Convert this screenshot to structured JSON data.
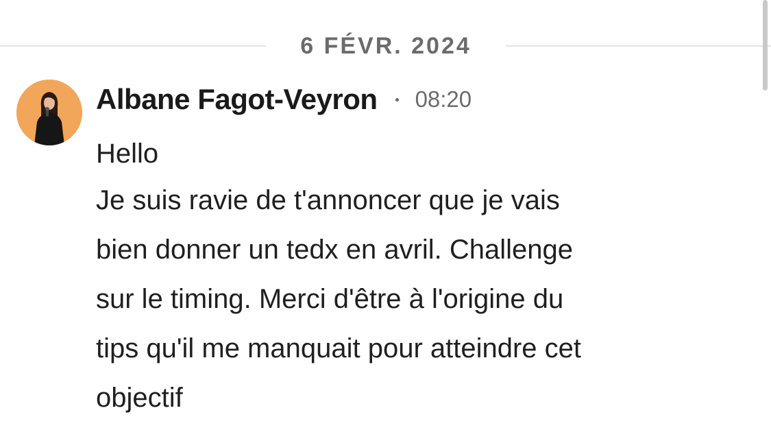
{
  "date_divider": {
    "label": "6 FÉVR. 2024"
  },
  "message": {
    "sender": "Albane Fagot-Veyron",
    "time": "08:20",
    "avatar": {
      "icon": "user-avatar-photo",
      "background": "#f2a65a"
    },
    "lines": [
      "Hello",
      "Je suis ravie de t'annoncer que je vais",
      "bien donner un tedx en avril. Challenge",
      "sur le timing. Merci d'être à l'origine du",
      "tips qu'il me manquait pour atteindre cet",
      "objectif"
    ]
  },
  "colors": {
    "text": "#1f1f1f",
    "muted": "#6b6b6b",
    "divider": "#e3e3e3",
    "scrollbar": "#c9c9c9"
  }
}
